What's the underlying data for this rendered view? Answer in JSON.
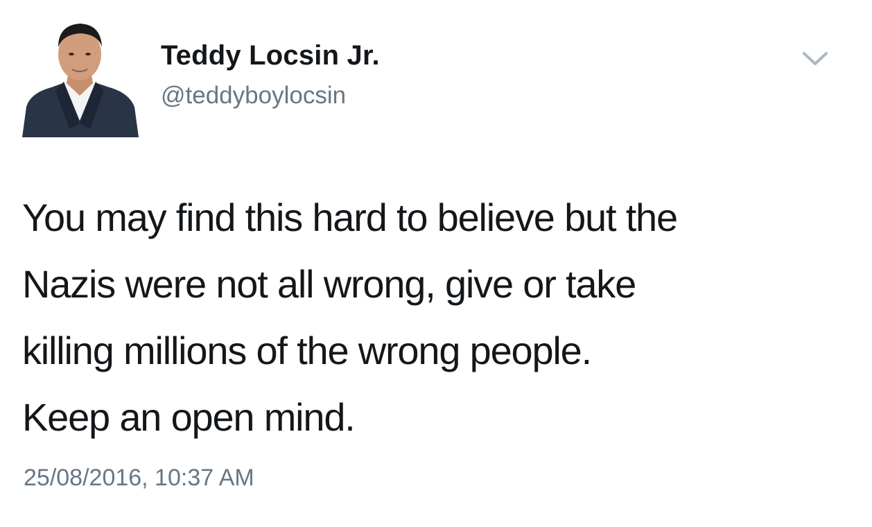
{
  "tweet": {
    "author": {
      "display_name": "Teddy Locsin Jr.",
      "handle": "@teddyboylocsin",
      "avatar_icon": "profile-photo"
    },
    "menu_icon": "chevron-down-icon",
    "text_lines": [
      "You may find this hard to believe but the",
      "Nazis were not all wrong, give or take",
      "killing millions of the wrong people.",
      "Keep an open mind."
    ],
    "timestamp": "25/08/2016, 10:37 AM"
  },
  "colors": {
    "text_primary": "#14171a",
    "text_secondary": "#657786",
    "chevron": "#aab8c2",
    "background": "#ffffff"
  }
}
